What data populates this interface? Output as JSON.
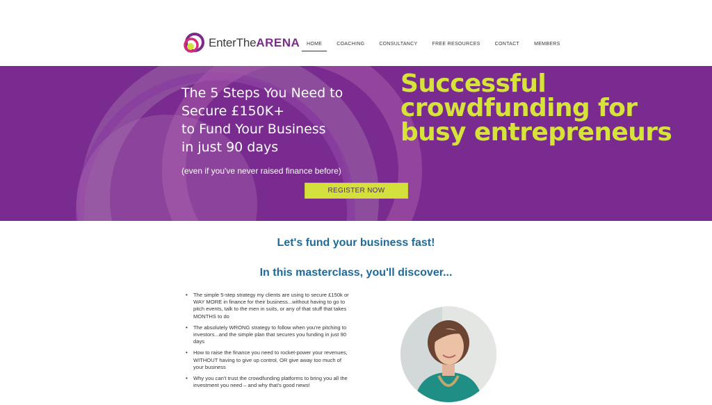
{
  "brand": {
    "prefix": "EnterThe",
    "suffix": "ARENA",
    "colors": {
      "purple": "#7b2a8a",
      "pink": "#d42a7c",
      "lime": "#d4e03b"
    }
  },
  "nav": {
    "items": [
      {
        "label": "HOME",
        "active": true
      },
      {
        "label": "COACHING",
        "active": false
      },
      {
        "label": "CONSULTANCY",
        "active": false
      },
      {
        "label": "FREE RESOURCES",
        "active": false
      },
      {
        "label": "CONTACT",
        "active": false
      },
      {
        "label": "MEMBERS",
        "active": false
      }
    ]
  },
  "hero": {
    "background": "#7a2b8f",
    "headline_lines": [
      "The 5 Steps You Need to",
      "Secure £150K+",
      "to Fund Your Business",
      "in just 90 days"
    ],
    "subheadline": "(even if you've never raised finance before)",
    "cta_label": "REGISTER NOW",
    "tagline_lines": [
      "Successful",
      "crowdfunding for",
      "busy entrepreneurs"
    ]
  },
  "content": {
    "title_1": "Let's fund your business fast!",
    "title_2": "In this masterclass, you'll discover...",
    "bullets": [
      "The simple 5-step strategy my clients are using to secure £150k or WAY MORE in finance for their business...without having to go to pitch events, talk to the men in suits, or any of that stuff that takes MONTHS to do",
      "The absolutely WRONG strategy to follow when you're pitching to investors...and the simple plan that secures you funding in just 90 days",
      "How to raise the finance you need to rocket-power your revenues, WITHOUT having to give up control, OR give away too much of your business",
      "Why you can't trust the crowdfunding platforms to bring you all the investment you need – and why that's good news!"
    ]
  }
}
